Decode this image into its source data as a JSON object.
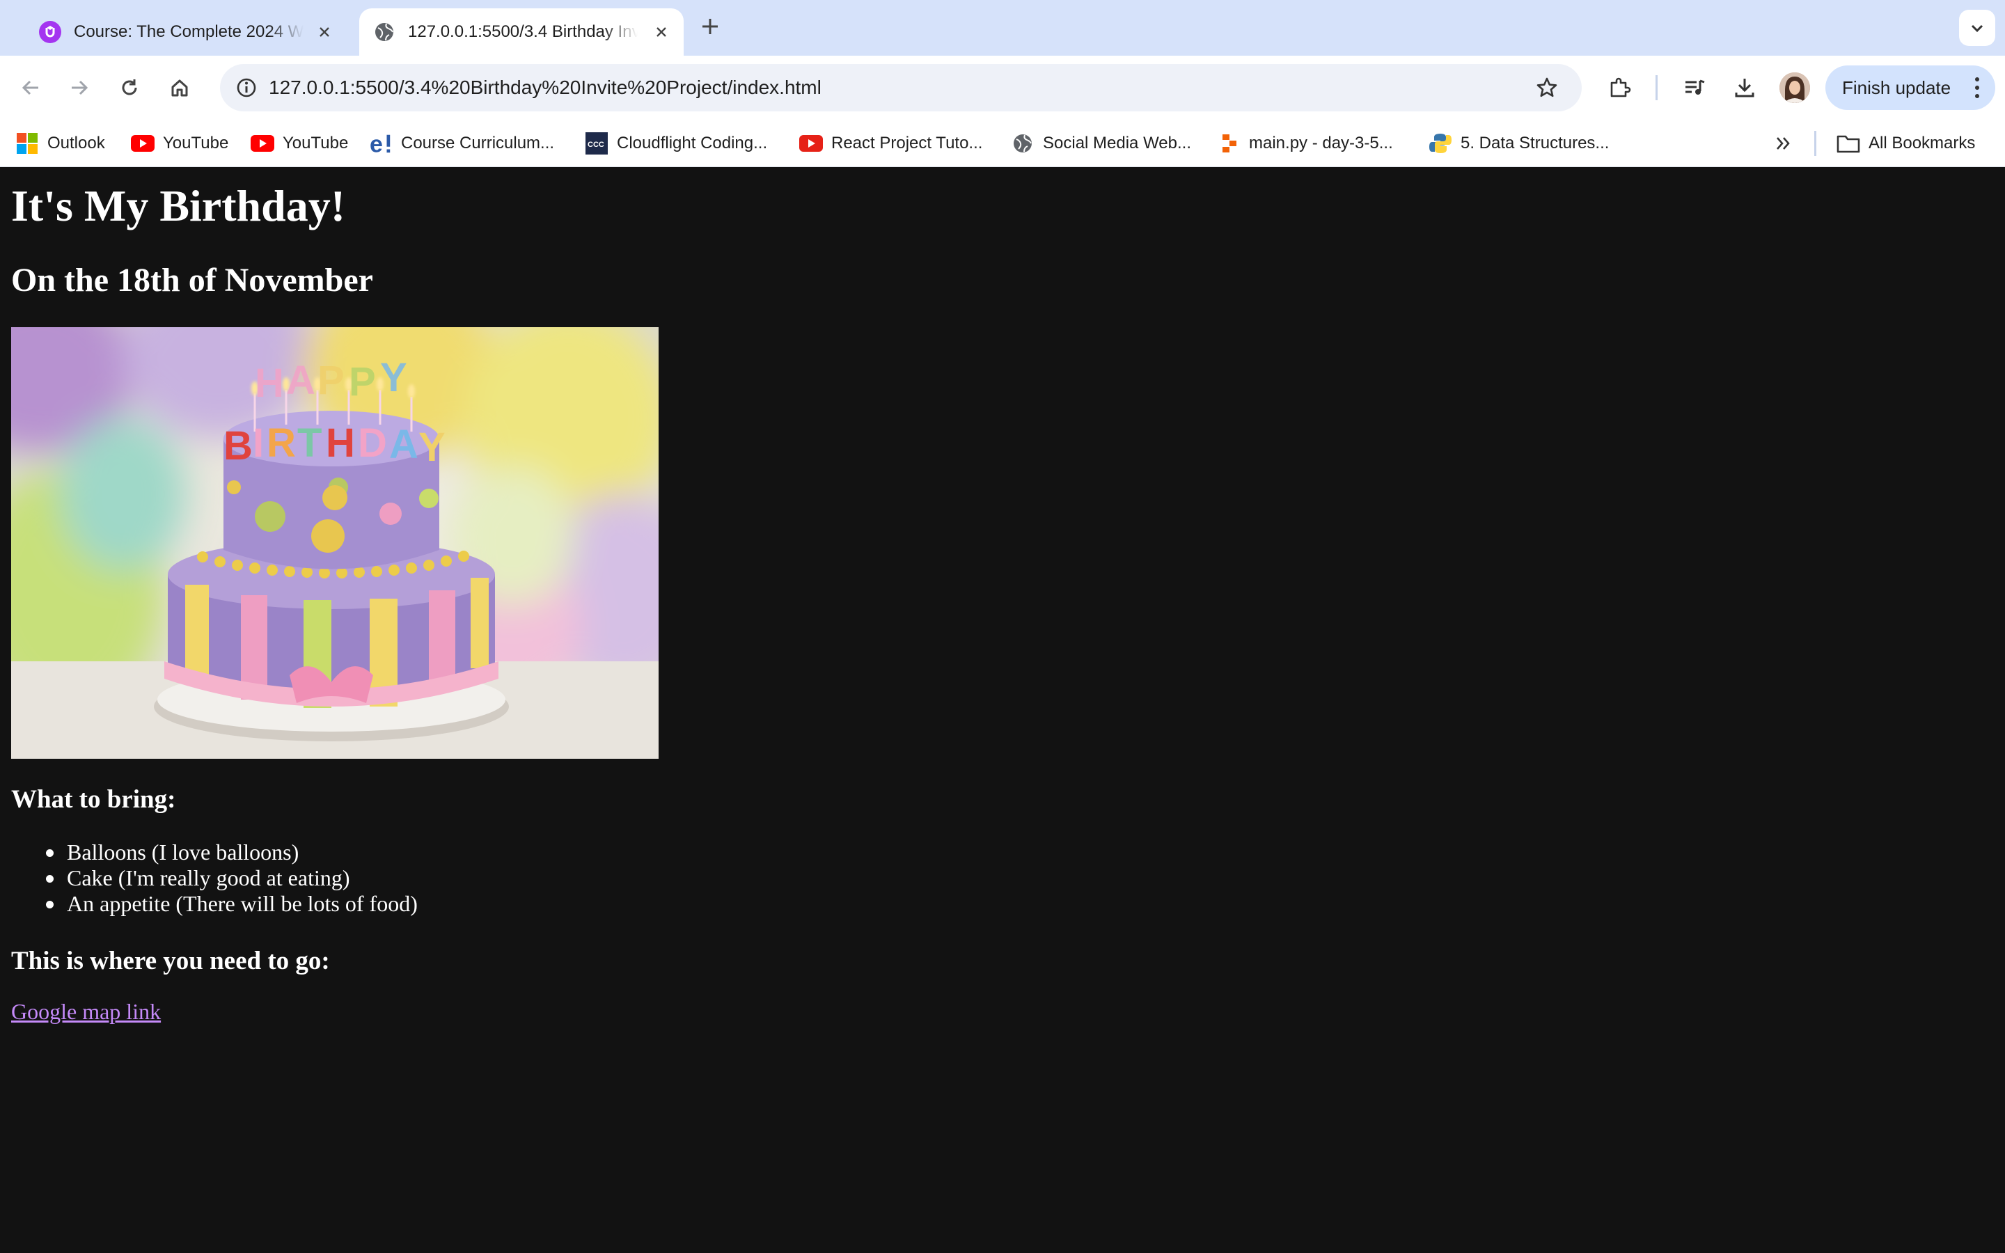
{
  "browser": {
    "tabs": [
      {
        "title": "Course: The Complete 2024 Web Development Bootcamp",
        "active": false,
        "icon": "udemy-icon"
      },
      {
        "title": "127.0.0.1:5500/3.4 Birthday Invite Project/index.html",
        "active": true,
        "icon": "globe-icon"
      }
    ],
    "url": "127.0.0.1:5500/3.4%20Birthday%20Invite%20Project/index.html",
    "update_button": "Finish update",
    "accent_color": "#d6e2fa",
    "bookmarks": [
      {
        "label": "Outlook",
        "icon": "microsoft-icon"
      },
      {
        "label": "YouTube",
        "icon": "youtube-icon"
      },
      {
        "label": "YouTube",
        "icon": "youtube-icon"
      },
      {
        "label": "Course Curriculum...",
        "icon": "e-icon"
      },
      {
        "label": "Cloudflight Coding...",
        "icon": "ccc-icon"
      },
      {
        "label": "React Project Tuto...",
        "icon": "youtube-icon"
      },
      {
        "label": "Social Media Web...",
        "icon": "globe-icon"
      },
      {
        "label": "main.py - day-3-5...",
        "icon": "replit-icon"
      },
      {
        "label": "5. Data Structures...",
        "icon": "python-icon"
      }
    ],
    "all_bookmarks": "All Bookmarks"
  },
  "page": {
    "heading": "It's My Birthday!",
    "subheading": "On the 18th of November",
    "bring_heading": "What to bring:",
    "bring_items": [
      "Balloons (I love balloons)",
      "Cake (I'm really good at eating)",
      "An appetite (There will be lots of food)"
    ],
    "where_heading": "This is where you need to go:",
    "map_link": "Google map link",
    "link_color": "#c58af9",
    "background_color": "#121212"
  }
}
